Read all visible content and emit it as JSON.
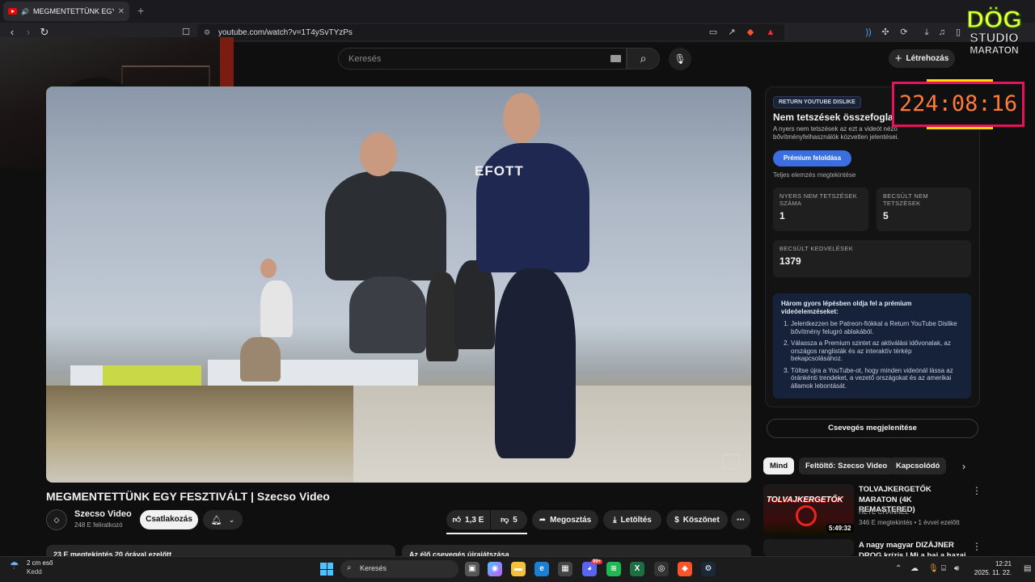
{
  "browser": {
    "tab_title": "MEGMENTETTÜNK EGY FESZTIVÁLT",
    "new_tab": "+",
    "url": "youtube.com/watch?v=1T4ySvTYzPs"
  },
  "youtube": {
    "search_placeholder": "Keresés",
    "create_label": "Létrehozás",
    "video_title": "MEGMENTETTÜNK EGY FESZTIVÁLT | Szecso Video",
    "video_overlay_text": "EFOTT",
    "channel_name": "Szecso Video",
    "subscribers": "248 E feliratkozó",
    "join_label": "Csatlakozás",
    "like_count": "1,3 E",
    "dislike_count": "5",
    "share_label": "Megosztás",
    "download_label": "Letöltés",
    "thanks_label": "Köszönet",
    "desc_left": "23 E megtekintés  20 órával ezelőtt",
    "desc_right": "Az élő csevegés újrajátszása"
  },
  "ryd": {
    "badge": "RETURN YOUTUBE DISLIKE",
    "title": "Nem tetszések összefoglalója",
    "description": "A nyers nem tetszések az ezt a videót néző bővítményfelhasználók közvetlen jelentései.",
    "premium_btn": "Prémium feloldása",
    "full_link": "Teljes elemzés megtekintése",
    "stats": [
      {
        "label": "NYERS NEM TETSZÉSEK SZÁMA",
        "value": "1"
      },
      {
        "label": "BECSÜLT NEM TETSZÉSEK",
        "value": "5"
      },
      {
        "label": "BECSÜLT KEDVELÉSEK",
        "value": "1379"
      }
    ],
    "promo_heading": "Három gyors lépésben oldja fel a prémium videóelemzéseket:",
    "promo_steps": [
      "Jelentkezzen be Patreon-fiókkal a Return YouTube Dislike bővítmény felugró ablakából.",
      "Válassza a Premium szintet az aktiválási idővonalak, az országos ranglisták és az interaktív térkép bekapcsolásához.",
      "Töltse újra a YouTube-ot, hogy minden videónál lássa az óránkénti trendeket, a vezető országokat és az amerikai államok lebontását."
    ]
  },
  "overlay": {
    "timer": "224:08:16",
    "logo_line1": "DÖG",
    "logo_line2": "STUDIO",
    "logo_line3": "MARATON"
  },
  "sidebar": {
    "chat_button": "Csevegés megjelenítése",
    "chips": [
      "Mind",
      "Feltöltő: Szecso Video",
      "Kapcsolódó"
    ],
    "videos": [
      {
        "thumb_text": "TOLVAJKERGETŐK",
        "title": "TOLVAJKERGETŐK MARATON (4K REMASTERED)",
        "channel": "HETE CHANNEL",
        "meta": "346 E megtekintés • 1 évvel ezelőtt",
        "duration": "5:49:32"
      },
      {
        "title": "A nagy magyar DIZÁJNER DROG krízis | Mi a baj a hazai"
      }
    ]
  },
  "taskbar": {
    "weather_temp": "2 cm eső",
    "weather_sub": "Kedd",
    "search_label": "Keresés",
    "time": "12:21",
    "date": "2025. 11. 22.",
    "discord_badge": "99+"
  },
  "colors": {
    "accent_blue": "#3b6fe0",
    "timer_border": "#e8125c",
    "timer_text": "#ff7a3a",
    "logo_yellow": "#e9ff39"
  }
}
